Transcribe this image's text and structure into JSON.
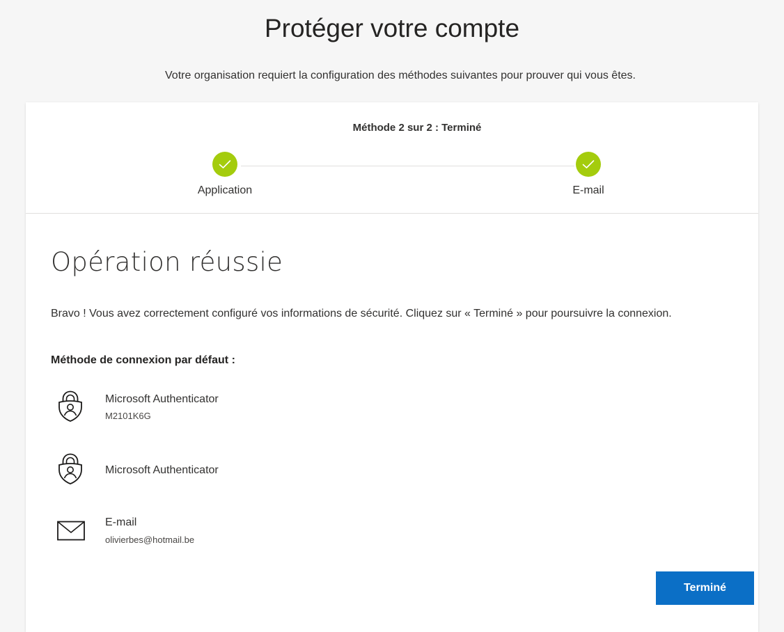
{
  "header": {
    "title": "Protéger votre compte",
    "subtitle": "Votre organisation requiert la configuration des méthodes suivantes pour prouver qui vous êtes."
  },
  "progress": {
    "status": "Méthode 2 sur 2 : Terminé",
    "steps": [
      {
        "label": "Application",
        "state": "completed"
      },
      {
        "label": "E-mail",
        "state": "completed"
      }
    ]
  },
  "main": {
    "heading": "Opération réussie",
    "message": "Bravo ! Vous avez correctement configuré vos informations de sécurité. Cliquez sur « Terminé » pour poursuivre la connexion.",
    "default_method_label": "Méthode de connexion par défaut :",
    "methods": [
      {
        "icon": "authenticator-icon",
        "name": "Microsoft Authenticator",
        "detail": "M2101K6G"
      },
      {
        "icon": "authenticator-icon",
        "name": "Microsoft Authenticator",
        "detail": ""
      },
      {
        "icon": "mail-icon",
        "name": "E-mail",
        "detail": "olivierbes@hotmail.be"
      }
    ],
    "done_label": "Terminé"
  },
  "colors": {
    "step_complete": "#a4cc0d",
    "primary_button": "#0b6fc6"
  }
}
